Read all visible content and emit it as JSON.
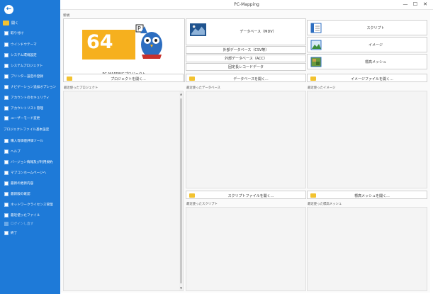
{
  "window": {
    "title": "PC-Mapping",
    "minimize": "—",
    "maximize": "☐",
    "close": "✕"
  },
  "sidebar": {
    "back_glyph": "←",
    "open_label": "開く",
    "items": [
      {
        "label": "取り付け"
      },
      {
        "label": "ウインドウテーマ"
      },
      {
        "label": "システム環境設定"
      },
      {
        "label": "システムプロジェクト"
      },
      {
        "label": "プリンター設定の登録"
      },
      {
        "label": "ナビゲーション追加オプション"
      },
      {
        "label": "アカウントのセキュリティ"
      },
      {
        "label": "アカウントリスト管理"
      },
      {
        "label": "ユーザーモード変更"
      }
    ],
    "section_label": "プロジェクトファイル基本設定",
    "items2": [
      {
        "label": "購入等価値評価ツール"
      },
      {
        "label": "ヘルプ"
      },
      {
        "label": "バージョン情報及び利用規約"
      },
      {
        "label": "マプコンホームページへ"
      },
      {
        "label": "最新の更新内容"
      },
      {
        "label": "最新版の確認"
      },
      {
        "label": "ネットワークライセンス管理"
      },
      {
        "label": "最近使ったファイル"
      }
    ],
    "disabled_item": "ログインし直す",
    "exit_label": "終了"
  },
  "main": {
    "new_label": "新規",
    "pcmap_card_label": "PC-MAPPINGプロジェクト",
    "logo_number": "64",
    "db_main": "データベース（MDV）",
    "db_csv": "外部データベース（CSV等）",
    "db_acc": "外部データベース（ACC）",
    "db_code": "固定長レコードデータ",
    "script": "スクリプト",
    "image": "イメージ",
    "mesh": "標高メッシュ",
    "open_project": "プロジェクトを開く...",
    "open_db": "データベースを開く...",
    "open_image": "イメージファイルを開く...",
    "open_script": "スクリプトファイルを開く...",
    "open_mesh": "標高メッシュを開く...",
    "recent_project": "最近使ったプロジェクト",
    "recent_db": "最近使ったデータベース",
    "recent_image": "最近使ったイメージ",
    "recent_script": "最近使ったスクリプト",
    "recent_mesh": "最近使った標高メッシュ"
  }
}
